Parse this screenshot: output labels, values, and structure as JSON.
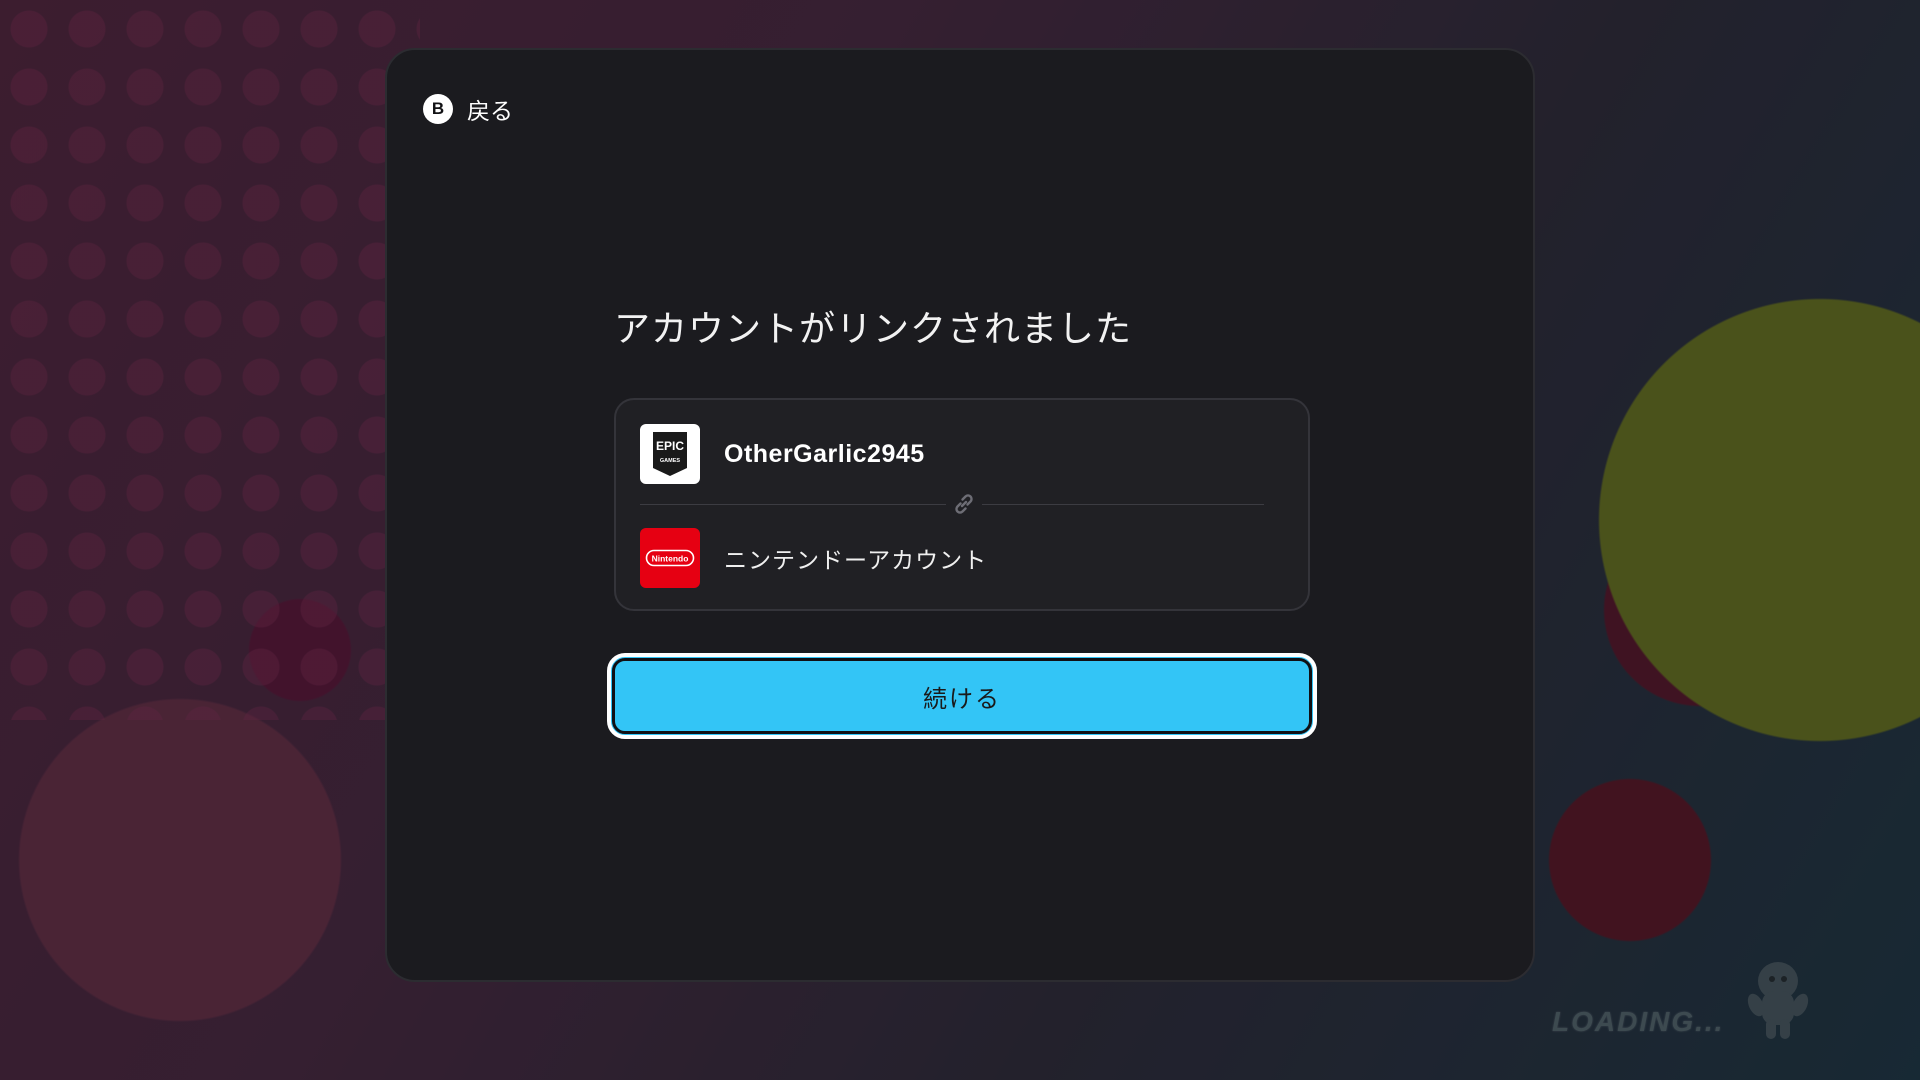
{
  "back": {
    "button_glyph": "B",
    "label": "戻る"
  },
  "dialog": {
    "title": "アカウントがリンクされました"
  },
  "accounts": [
    {
      "name": "OtherGarlic2945",
      "logo_icon": "epic-games-logo",
      "logo_text_top": "EPIC",
      "logo_text_bottom": "GAMES"
    },
    {
      "name": "ニンテンドーアカウント",
      "logo_icon": "nintendo-logo",
      "logo_text": "Nintendo"
    }
  ],
  "link_icon": "link-icon",
  "continue_button": {
    "label": "続ける"
  },
  "loading": {
    "label": "LOADING..."
  },
  "colors": {
    "dialog_bg": "#1b1b1f",
    "button_accent": "#33c5f6",
    "nintendo_red": "#e60012"
  }
}
